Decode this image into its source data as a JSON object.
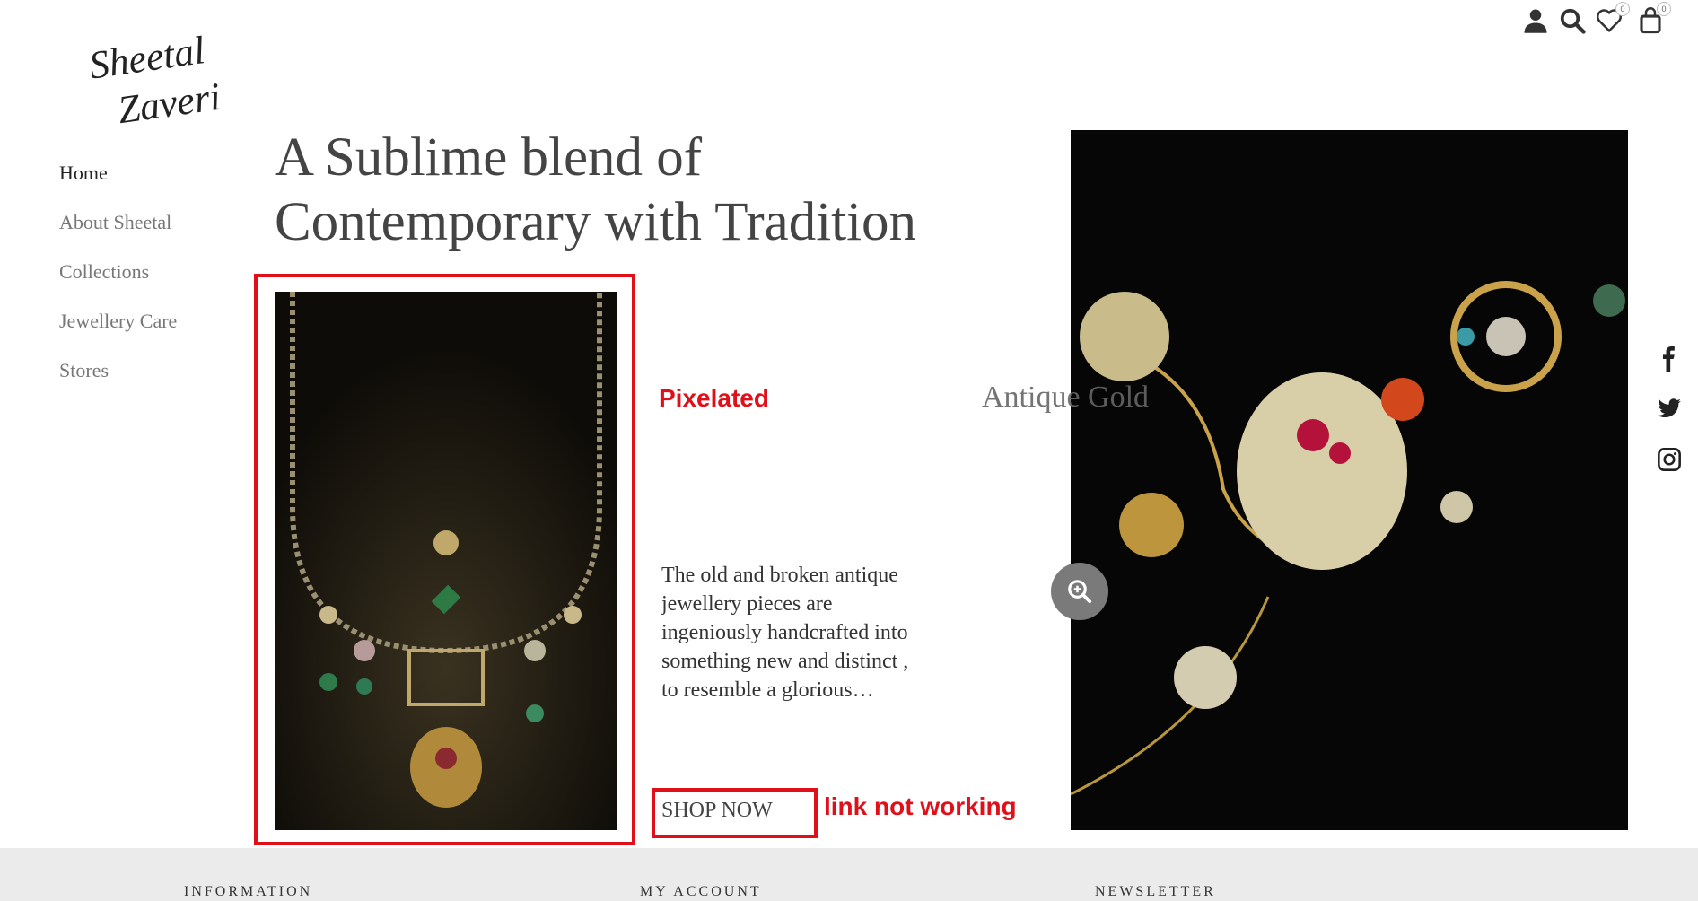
{
  "brand": {
    "logo_line1": "Sheetal",
    "logo_line2": "Zaveri"
  },
  "header": {
    "icons": [
      "account-icon",
      "search-icon",
      "wishlist-icon",
      "cart-icon"
    ],
    "wishlist_count": "0",
    "cart_count": "0"
  },
  "nav": {
    "items": [
      {
        "label": "Home"
      },
      {
        "label": "About Sheetal"
      },
      {
        "label": "Collections"
      },
      {
        "label": "Jewellery Care"
      },
      {
        "label": "Stores"
      }
    ]
  },
  "main": {
    "headline_line1": "A Sublime blend of",
    "headline_line2": "Contemporary with Tradition",
    "collection_label": "Antique Gold",
    "description": "The old and broken antique jewellery pieces are ingeniously handcrafted  into something new and distinct , to resemble a glorious…",
    "shop_now": "SHOP NOW"
  },
  "annotations": {
    "pixelated": "Pixelated",
    "link_not_working": "link not working",
    "color": "#e0101a"
  },
  "social": [
    "facebook-icon",
    "twitter-icon",
    "instagram-icon"
  ],
  "footer": {
    "information": "INFORMATION",
    "my_account": "MY ACCOUNT",
    "newsletter": "NEWSLETTER"
  }
}
